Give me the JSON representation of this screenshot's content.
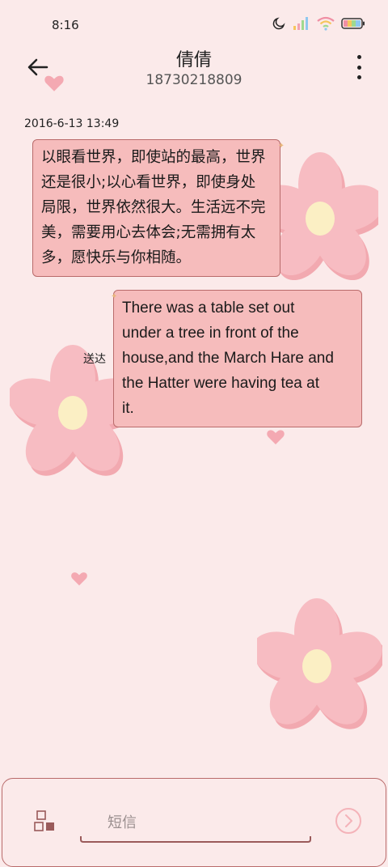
{
  "status_bar": {
    "time": "8:16",
    "icons": [
      "moon-icon",
      "signal-icon",
      "wifi-icon",
      "battery-icon"
    ]
  },
  "header": {
    "contact_name": "倩倩",
    "contact_number": "18730218809",
    "back_icon": "arrow-left-icon",
    "more_icon": "more-vertical-icon"
  },
  "conversation": {
    "timestamp": "2016-6-13 13:49",
    "messages": [
      {
        "direction": "incoming",
        "lines": [
          "以眼看世界，即使站的最高，世界",
          "还是很小;以心看世界，即使身处",
          "局限，世界依然很大。生活远不完",
          "美，需要用心去体会;无需拥有太",
          "多，愿快乐与你相随。"
        ]
      },
      {
        "direction": "outgoing",
        "lines": [
          "There was a table set out",
          "under a tree in front of the",
          "house,and the March Hare and",
          "the Hatter were having tea at",
          "it."
        ],
        "status": "送达"
      }
    ]
  },
  "compose": {
    "placeholder": "短信",
    "attach_icon": "attachment-grid-icon",
    "send_icon": "send-circle-icon"
  },
  "colors": {
    "background": "#fbeaea",
    "bubble_fill": "#f6bcbc",
    "bubble_border": "#b96b6b",
    "flower_petal": "#f7b8be",
    "flower_center": "#fbefc4"
  }
}
